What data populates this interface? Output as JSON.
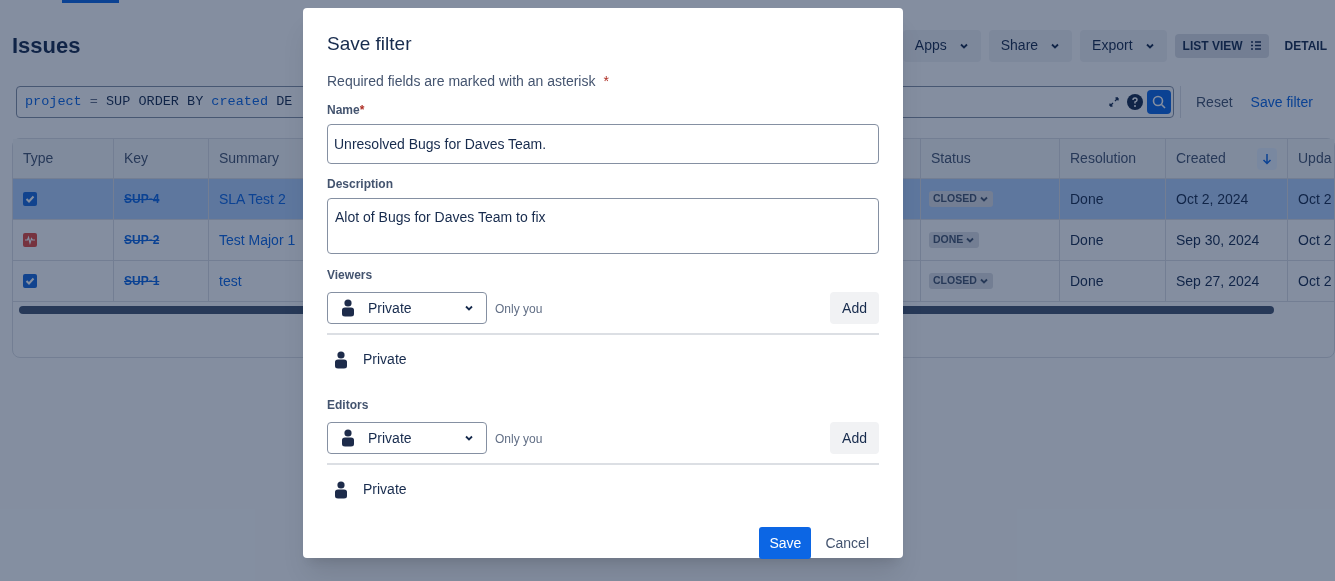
{
  "page": {
    "title": "Issues"
  },
  "toolbar": [
    {
      "label": "Apps",
      "kind": "menu"
    },
    {
      "label": "Share",
      "kind": "menu"
    },
    {
      "label": "Export",
      "kind": "menu"
    },
    {
      "label": "LIST VIEW",
      "kind": "view",
      "selected": true
    },
    {
      "label": "DETAIL",
      "kind": "view",
      "selected": false
    }
  ],
  "search": {
    "tokens": [
      {
        "text": "project",
        "kind": "field"
      },
      {
        "text": "=",
        "kind": "operator"
      },
      {
        "text": "SUP ORDER BY",
        "kind": "plain"
      },
      {
        "text": "created",
        "kind": "field"
      },
      {
        "text": "DE",
        "kind": "plain"
      }
    ]
  },
  "search_actions": [
    {
      "label": "Reset",
      "kind": "plain"
    },
    {
      "label": "Save filter",
      "kind": "link"
    }
  ],
  "table": {
    "columns": [
      {
        "label": "Type"
      },
      {
        "label": "Key"
      },
      {
        "label": "Summary"
      },
      {
        "label": "Status"
      },
      {
        "label": "Resolution"
      },
      {
        "label": "Created",
        "sorted": true
      },
      {
        "label": "Upda"
      }
    ],
    "rows": [
      {
        "kind": "task",
        "key": "SUP-4",
        "resolved": true,
        "summary": "SLA Test 2",
        "status": "CLOSED",
        "resolution": "Done",
        "created": "Oct 2, 2024",
        "updated": "Oct 2",
        "selected": true
      },
      {
        "kind": "bug",
        "key": "SUP-2",
        "resolved": true,
        "summary": "Test Major 1",
        "status": "DONE",
        "resolution": "Done",
        "created": "Sep 30, 2024",
        "updated": "Oct 2",
        "selected": false
      },
      {
        "kind": "task",
        "key": "SUP-1",
        "resolved": true,
        "summary": "test",
        "status": "CLOSED",
        "resolution": "Done",
        "created": "Sep 27, 2024",
        "updated": "Oct 2",
        "selected": false
      }
    ]
  },
  "dialog": {
    "title": "Save filter",
    "note": "Required fields are marked with an asterisk",
    "required_mark": "*",
    "name": {
      "label": "Name",
      "required": true,
      "value": "Unresolved Bugs for Daves Team."
    },
    "description": {
      "label": "Description",
      "value": "Alot of Bugs for Daves Team to fix"
    },
    "sharing": [
      {
        "label": "Viewers",
        "select": "Private",
        "hint": "Only you",
        "button": "Add",
        "entries": [
          "Private"
        ]
      },
      {
        "label": "Editors",
        "select": "Private",
        "hint": "Only you",
        "button": "Add",
        "entries": [
          "Private"
        ]
      }
    ],
    "buttons": [
      {
        "label": "Save",
        "kind": "primary"
      },
      {
        "label": "Cancel",
        "kind": "subtle"
      }
    ]
  }
}
